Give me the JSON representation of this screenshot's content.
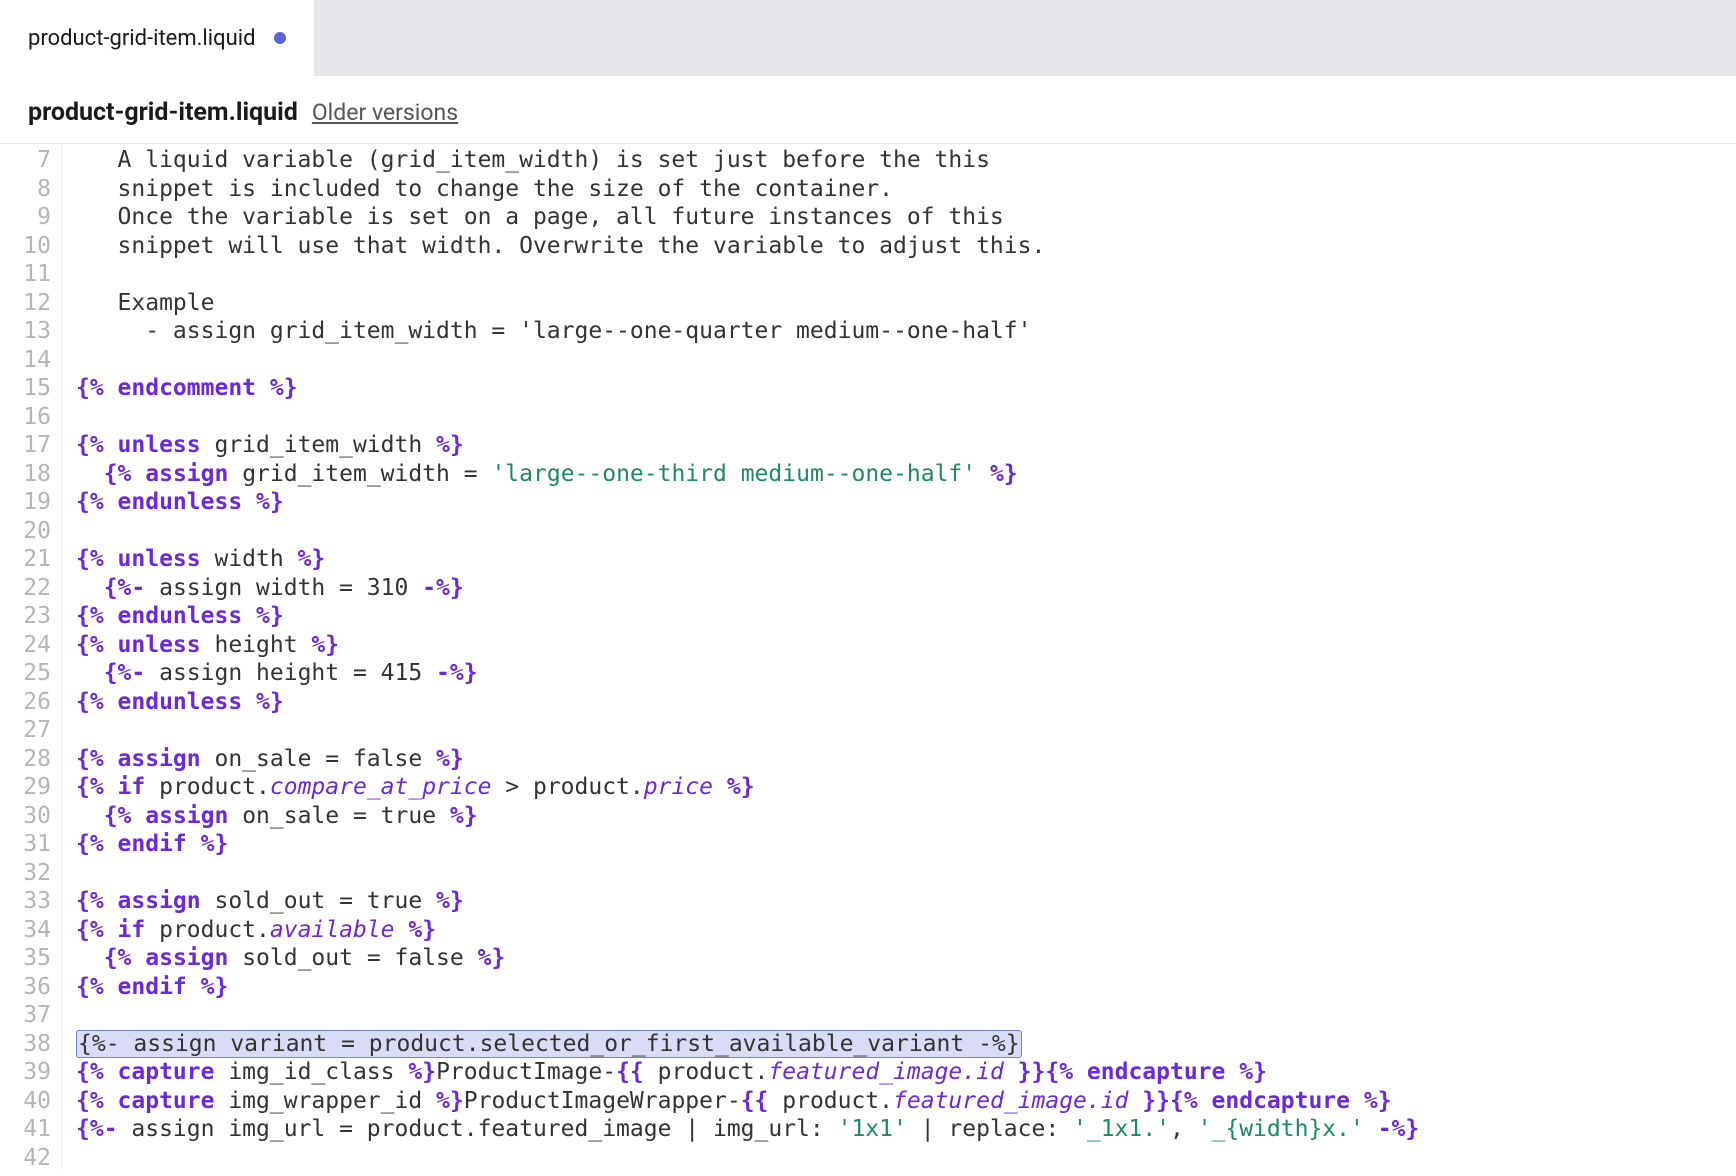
{
  "tab": {
    "label": "product-grid-item.liquid",
    "dirty": true
  },
  "header": {
    "title": "product-grid-item.liquid",
    "older_versions": "Older versions"
  },
  "first_line_number": 7,
  "last_line_number": 42,
  "code_lines": [
    {
      "n": 7,
      "cls": "",
      "raw": "   A liquid variable (grid_item_width) is set just before the this"
    },
    {
      "n": 8,
      "cls": "",
      "raw": "   snippet is included to change the size of the container."
    },
    {
      "n": 9,
      "cls": "",
      "raw": "   Once the variable is set on a page, all future instances of this"
    },
    {
      "n": 10,
      "cls": "",
      "raw": "   snippet will use that width. Overwrite the variable to adjust this."
    },
    {
      "n": 11,
      "cls": "",
      "raw": ""
    },
    {
      "n": 12,
      "cls": "",
      "raw": "   Example"
    },
    {
      "n": 13,
      "cls": "",
      "raw": "     - assign grid_item_width = 'large--one-quarter medium--one-half'"
    },
    {
      "n": 14,
      "cls": "",
      "raw": ""
    },
    {
      "n": 15,
      "cls": "code",
      "tokens": [
        [
          "{% ",
          "tag"
        ],
        [
          "endcomment",
          "kw"
        ],
        [
          " %}",
          "tag"
        ]
      ]
    },
    {
      "n": 16,
      "cls": "",
      "raw": ""
    },
    {
      "n": 17,
      "cls": "code",
      "tokens": [
        [
          "{% ",
          "tag"
        ],
        [
          "unless",
          "kw"
        ],
        [
          " grid_item_width ",
          "plain"
        ],
        [
          "%}",
          "tag"
        ]
      ]
    },
    {
      "n": 18,
      "cls": "code",
      "tokens": [
        [
          "  ",
          "plain"
        ],
        [
          "{% ",
          "tag"
        ],
        [
          "assign",
          "kw"
        ],
        [
          " grid_item_width = ",
          "plain"
        ],
        [
          "'large--one-third medium--one-half'",
          "str"
        ],
        [
          " %}",
          "tag"
        ]
      ]
    },
    {
      "n": 19,
      "cls": "code",
      "tokens": [
        [
          "{% ",
          "tag"
        ],
        [
          "endunless",
          "kw"
        ],
        [
          " %}",
          "tag"
        ]
      ]
    },
    {
      "n": 20,
      "cls": "",
      "raw": ""
    },
    {
      "n": 21,
      "cls": "code",
      "tokens": [
        [
          "{% ",
          "tag"
        ],
        [
          "unless",
          "kw"
        ],
        [
          " width ",
          "plain"
        ],
        [
          "%}",
          "tag"
        ]
      ]
    },
    {
      "n": 22,
      "cls": "code",
      "tokens": [
        [
          "  ",
          "plain"
        ],
        [
          "{%- ",
          "tag"
        ],
        [
          "assign width = 310 ",
          "plain"
        ],
        [
          "-%}",
          "tag"
        ]
      ]
    },
    {
      "n": 23,
      "cls": "code",
      "tokens": [
        [
          "{% ",
          "tag"
        ],
        [
          "endunless",
          "kw"
        ],
        [
          " %}",
          "tag"
        ]
      ]
    },
    {
      "n": 24,
      "cls": "code",
      "tokens": [
        [
          "{% ",
          "tag"
        ],
        [
          "unless",
          "kw"
        ],
        [
          " height ",
          "plain"
        ],
        [
          "%}",
          "tag"
        ]
      ]
    },
    {
      "n": 25,
      "cls": "code",
      "tokens": [
        [
          "  ",
          "plain"
        ],
        [
          "{%- ",
          "tag"
        ],
        [
          "assign height = 415 ",
          "plain"
        ],
        [
          "-%}",
          "tag"
        ]
      ]
    },
    {
      "n": 26,
      "cls": "code",
      "tokens": [
        [
          "{% ",
          "tag"
        ],
        [
          "endunless",
          "kw"
        ],
        [
          " %}",
          "tag"
        ]
      ]
    },
    {
      "n": 27,
      "cls": "",
      "raw": ""
    },
    {
      "n": 28,
      "cls": "code",
      "tokens": [
        [
          "{% ",
          "tag"
        ],
        [
          "assign",
          "kw"
        ],
        [
          " on_sale = false ",
          "plain"
        ],
        [
          "%}",
          "tag"
        ]
      ]
    },
    {
      "n": 29,
      "cls": "code",
      "tokens": [
        [
          "{% ",
          "tag"
        ],
        [
          "if",
          "kw"
        ],
        [
          " product.",
          "plain"
        ],
        [
          "compare_at_price",
          "prop"
        ],
        [
          " > product.",
          "plain"
        ],
        [
          "price",
          "prop"
        ],
        [
          " %}",
          "tag"
        ]
      ]
    },
    {
      "n": 30,
      "cls": "code",
      "tokens": [
        [
          "  ",
          "plain"
        ],
        [
          "{% ",
          "tag"
        ],
        [
          "assign",
          "kw"
        ],
        [
          " on_sale = true ",
          "plain"
        ],
        [
          "%}",
          "tag"
        ]
      ]
    },
    {
      "n": 31,
      "cls": "code",
      "tokens": [
        [
          "{% ",
          "tag"
        ],
        [
          "endif",
          "kw"
        ],
        [
          " %}",
          "tag"
        ]
      ]
    },
    {
      "n": 32,
      "cls": "",
      "raw": ""
    },
    {
      "n": 33,
      "cls": "code",
      "tokens": [
        [
          "{% ",
          "tag"
        ],
        [
          "assign",
          "kw"
        ],
        [
          " sold_out = true ",
          "plain"
        ],
        [
          "%}",
          "tag"
        ]
      ]
    },
    {
      "n": 34,
      "cls": "code",
      "tokens": [
        [
          "{% ",
          "tag"
        ],
        [
          "if",
          "kw"
        ],
        [
          " product.",
          "plain"
        ],
        [
          "available",
          "prop"
        ],
        [
          " %}",
          "tag"
        ]
      ]
    },
    {
      "n": 35,
      "cls": "code",
      "tokens": [
        [
          "  ",
          "plain"
        ],
        [
          "{% ",
          "tag"
        ],
        [
          "assign",
          "kw"
        ],
        [
          " sold_out = false ",
          "plain"
        ],
        [
          "%}",
          "tag"
        ]
      ]
    },
    {
      "n": 36,
      "cls": "code",
      "tokens": [
        [
          "{% ",
          "tag"
        ],
        [
          "endif",
          "kw"
        ],
        [
          " %}",
          "tag"
        ]
      ]
    },
    {
      "n": 37,
      "cls": "",
      "raw": ""
    },
    {
      "n": 38,
      "cls": "hl",
      "raw": "{%- assign variant = product.selected_or_first_available_variant -%}"
    },
    {
      "n": 39,
      "cls": "code",
      "tokens": [
        [
          "{% ",
          "tag"
        ],
        [
          "capture",
          "kw"
        ],
        [
          " img_id_class ",
          "plain"
        ],
        [
          "%}",
          "tag"
        ],
        [
          "ProductImage-",
          "plain"
        ],
        [
          "{{ ",
          "tag"
        ],
        [
          "product.",
          "plain"
        ],
        [
          "featured_image.id",
          "prop"
        ],
        [
          " }}",
          "tag"
        ],
        [
          "{% ",
          "tag"
        ],
        [
          "endcapture",
          "kw"
        ],
        [
          " %}",
          "tag"
        ]
      ]
    },
    {
      "n": 40,
      "cls": "code",
      "tokens": [
        [
          "{% ",
          "tag"
        ],
        [
          "capture",
          "kw"
        ],
        [
          " img_wrapper_id ",
          "plain"
        ],
        [
          "%}",
          "tag"
        ],
        [
          "ProductImageWrapper-",
          "plain"
        ],
        [
          "{{ ",
          "tag"
        ],
        [
          "product.",
          "plain"
        ],
        [
          "featured_image.id",
          "prop"
        ],
        [
          " }}",
          "tag"
        ],
        [
          "{% ",
          "tag"
        ],
        [
          "endcapture",
          "kw"
        ],
        [
          " %}",
          "tag"
        ]
      ]
    },
    {
      "n": 41,
      "cls": "code",
      "tokens": [
        [
          "{%- ",
          "tag"
        ],
        [
          "assign img_url = product.featured_image | img_url: ",
          "plain"
        ],
        [
          "'1x1'",
          "str"
        ],
        [
          " | replace: ",
          "plain"
        ],
        [
          "'_1x1.'",
          "str"
        ],
        [
          ", ",
          "plain"
        ],
        [
          "'_{width}x.'",
          "str"
        ],
        [
          " -%}",
          "tag"
        ]
      ]
    },
    {
      "n": 42,
      "cls": "",
      "raw": ""
    }
  ]
}
